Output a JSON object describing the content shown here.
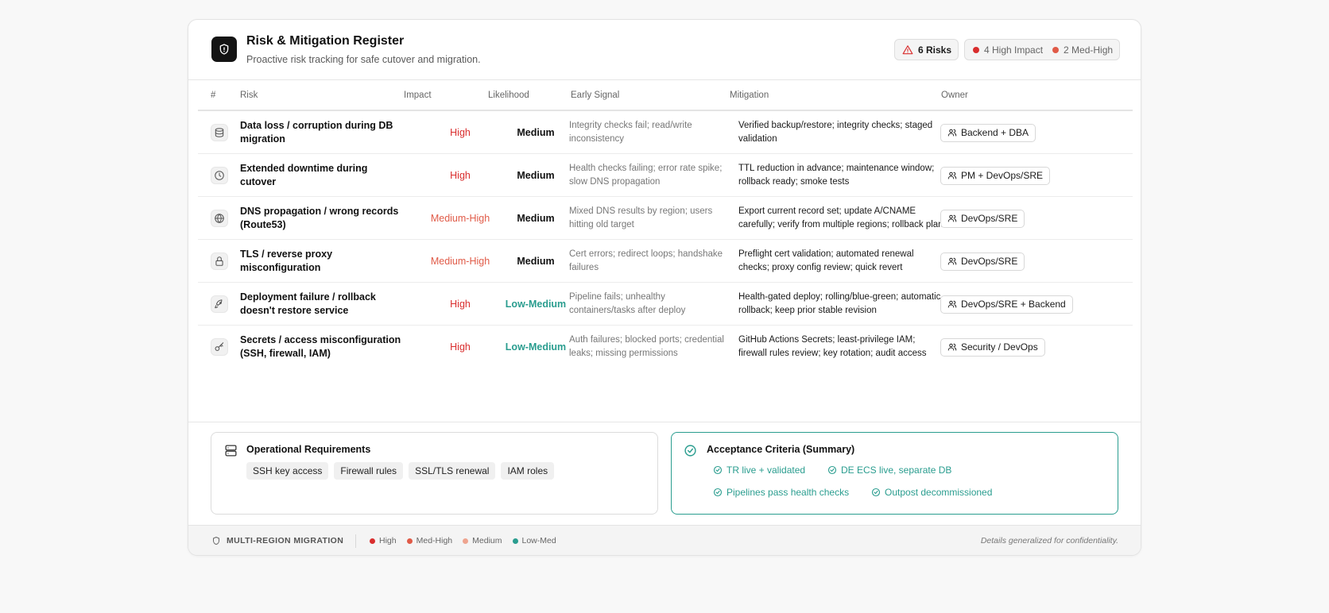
{
  "header": {
    "title": "Risk & Mitigation Register",
    "subtitle": "Proactive risk tracking for safe cutover and migration.",
    "risk_count": "6 Risks",
    "high_impact": "4 High Impact",
    "med_high": "2 Med-High"
  },
  "table": {
    "columns": [
      "#",
      "Risk",
      "Impact",
      "Likelihood",
      "Early Signal",
      "Mitigation",
      "Owner"
    ],
    "rows": [
      {
        "icon": "database-icon",
        "risk": "Data loss / corruption during DB migration",
        "impact": "High",
        "likelihood": "Medium",
        "signal": "Integrity checks fail; read/write inconsistency",
        "mitigation": "Verified backup/restore; integrity checks; staged validation",
        "owner": "Backend + DBA"
      },
      {
        "icon": "clock-icon",
        "risk": "Extended downtime during cutover",
        "impact": "High",
        "likelihood": "Medium",
        "signal": "Health checks failing; error rate spike; slow DNS propagation",
        "mitigation": "TTL reduction in advance; maintenance window; rollback ready; smoke tests",
        "owner": "PM + DevOps/SRE"
      },
      {
        "icon": "globe-icon",
        "risk": "DNS propagation / wrong records (Route53)",
        "impact": "Medium-High",
        "likelihood": "Medium",
        "signal": "Mixed DNS results by region; users hitting old target",
        "mitigation": "Export current record set; update A/CNAME carefully; verify from multiple regions; rollback plan",
        "owner": "DevOps/SRE"
      },
      {
        "icon": "lock-icon",
        "risk": "TLS / reverse proxy misconfiguration",
        "impact": "Medium-High",
        "likelihood": "Medium",
        "signal": "Cert errors; redirect loops; handshake failures",
        "mitigation": "Preflight cert validation; automated renewal checks; proxy config review; quick revert",
        "owner": "DevOps/SRE"
      },
      {
        "icon": "rocket-icon",
        "risk": "Deployment failure / rollback doesn't restore service",
        "impact": "High",
        "likelihood": "Low-Medium",
        "signal": "Pipeline fails; unhealthy containers/tasks after deploy",
        "mitigation": "Health-gated deploy; rolling/blue-green; automatic rollback; keep prior stable revision",
        "owner": "DevOps/SRE + Backend"
      },
      {
        "icon": "key-icon",
        "risk": "Secrets / access misconfiguration (SSH, firewall, IAM)",
        "impact": "High",
        "likelihood": "Low-Medium",
        "signal": "Auth failures; blocked ports; credential leaks; missing permissions",
        "mitigation": "GitHub Actions Secrets; least-privilege IAM; firewall rules review; key rotation; audit access",
        "owner": "Security / DevOps"
      }
    ]
  },
  "operational": {
    "title": "Operational Requirements",
    "chips": [
      "SSH key access",
      "Firewall rules",
      "SSL/TLS renewal",
      "IAM roles"
    ]
  },
  "acceptance": {
    "title": "Acceptance Criteria (Summary)",
    "items": [
      "TR live + validated",
      "DE ECS live, separate DB",
      "Pipelines pass health checks",
      "Outpost decommissioned"
    ]
  },
  "footer": {
    "label": "MULTI-REGION MIGRATION",
    "legend": [
      "High",
      "Med-High",
      "Medium",
      "Low-Med"
    ],
    "note": "Details generalized for confidentiality."
  },
  "colors": {
    "high": "#d92d2d",
    "med_high": "#e05a47",
    "medium": "#eea48f",
    "low_med": "#2a9d8f",
    "accent": "#2a9d8f"
  }
}
